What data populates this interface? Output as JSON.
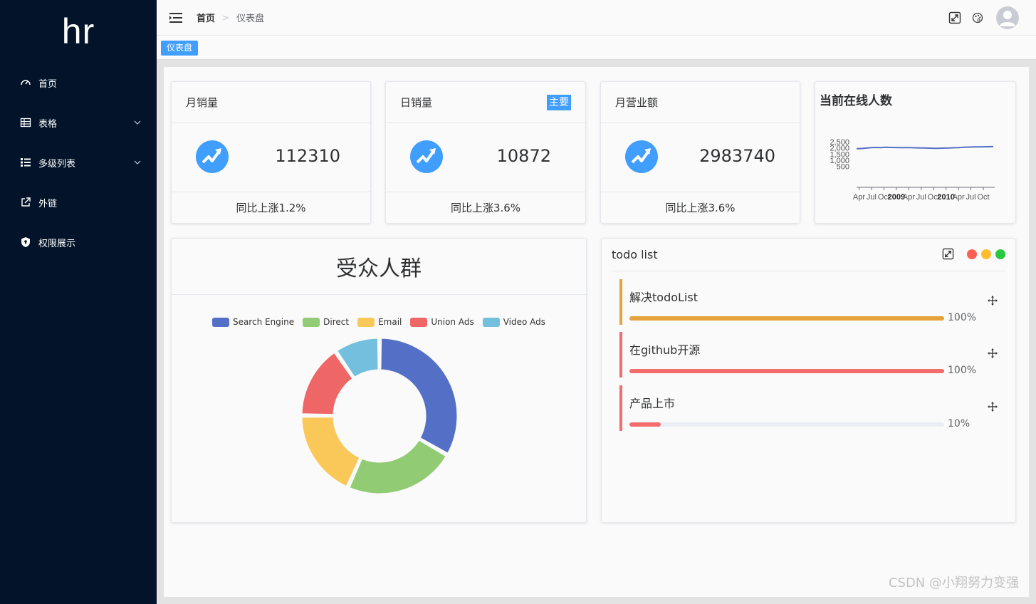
{
  "logo": "hr",
  "sidebar": {
    "items": [
      {
        "label": "首页",
        "icon": "dashboard-icon",
        "has_arrow": false
      },
      {
        "label": "表格",
        "icon": "table-icon",
        "has_arrow": true
      },
      {
        "label": "多级列表",
        "icon": "list-icon",
        "has_arrow": true
      },
      {
        "label": "外链",
        "icon": "external-link-icon",
        "has_arrow": false
      },
      {
        "label": "权限展示",
        "icon": "shield-icon",
        "has_arrow": false
      }
    ]
  },
  "header": {
    "breadcrumb_home": "首页",
    "breadcrumb_sep": ">",
    "breadcrumb_current": "仪表盘",
    "icons": [
      "fullscreen-icon",
      "theme-palette-icon",
      "avatar"
    ]
  },
  "tags": {
    "active": "仪表盘"
  },
  "colors": {
    "sidebar_bg": "#03142a",
    "accent": "#409eff",
    "todo_orange": "#e6a23c",
    "todo_red": "#f56c6c",
    "dot_red": "#ff5f57",
    "dot_yellow": "#febc2e",
    "dot_green": "#28c840"
  },
  "stats": [
    {
      "title": "月销量",
      "value": "112310",
      "footer": "同比上涨1.2%",
      "badge": ""
    },
    {
      "title": "日销量",
      "value": "10872",
      "footer": "同比上涨3.6%",
      "badge": "主要"
    },
    {
      "title": "月营业额",
      "value": "2983740",
      "footer": "同比上涨3.6%",
      "badge": ""
    }
  ],
  "online": {
    "title": "当前在线人数"
  },
  "audience": {
    "title": "受众人群"
  },
  "todo": {
    "title": "todo list",
    "items": [
      {
        "text": "解决todoList",
        "percent_label": "100%",
        "progress": 1.0,
        "color": "#e6a23c"
      },
      {
        "text": "在github开源",
        "percent_label": "100%",
        "progress": 1.0,
        "color": "#f56c6c"
      },
      {
        "text": "产品上市",
        "percent_label": "10%",
        "progress": 0.1,
        "color": "#f56c6c"
      }
    ]
  },
  "watermark": "CSDN @小翔努力变强",
  "chart_data": [
    {
      "type": "line",
      "title": "",
      "yticks": [
        "2,500",
        "2,000",
        "1,500",
        "1,000",
        "500"
      ],
      "xticks": [
        "Apr",
        "Jul",
        "Oct",
        "2009",
        "Apr",
        "Jul",
        "Oct",
        "2010",
        "Apr",
        "Jul",
        "Oct"
      ],
      "bold_xticks": [
        "2009",
        "2010"
      ],
      "ylim": [
        0,
        2800
      ],
      "series": [
        {
          "values": [
            2000,
            2010,
            2050,
            2080,
            2100,
            2090,
            2110,
            2100,
            2095,
            2085,
            2090,
            2080,
            2070,
            2060,
            2055,
            2040,
            2030,
            2035,
            2045,
            2055,
            2075,
            2090,
            2110,
            2130,
            2140,
            2145,
            2150,
            2160,
            2170
          ]
        }
      ]
    },
    {
      "type": "pie",
      "donut": true,
      "series": [
        {
          "name": "Search Engine",
          "value": 1048,
          "color": "#5470c6"
        },
        {
          "name": "Direct",
          "value": 735,
          "color": "#91cc75"
        },
        {
          "name": "Email",
          "value": 580,
          "color": "#fac858"
        },
        {
          "name": "Union Ads",
          "value": 484,
          "color": "#ee6666"
        },
        {
          "name": "Video Ads",
          "value": 300,
          "color": "#73c0de"
        }
      ]
    }
  ]
}
